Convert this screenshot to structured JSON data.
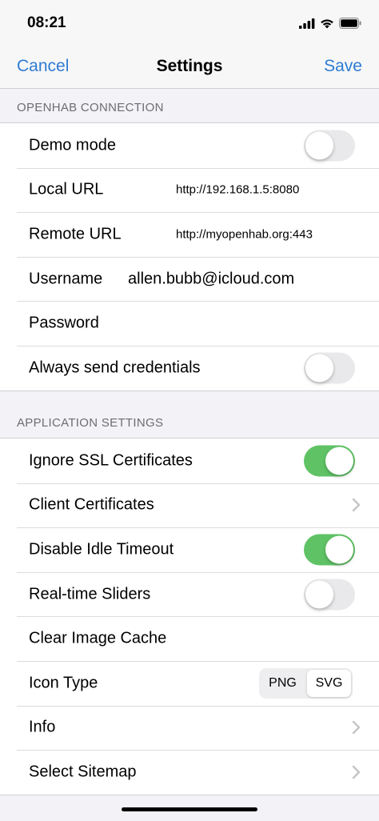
{
  "status_bar": {
    "time": "08:21"
  },
  "nav": {
    "cancel": "Cancel",
    "title": "Settings",
    "save": "Save"
  },
  "openhab_connection": {
    "header": "OPENHAB CONNECTION",
    "demo_mode": {
      "label": "Demo mode",
      "on": false
    },
    "local_url": {
      "label": "Local URL",
      "value": "http://192.168.1.5:8080"
    },
    "remote_url": {
      "label": "Remote URL",
      "value": "http://myopenhab.org:443"
    },
    "username": {
      "label": "Username",
      "value": "allen.bubb@icloud.com"
    },
    "password": {
      "label": "Password",
      "value": ""
    },
    "always_send_credentials": {
      "label": "Always send credentials",
      "on": false
    }
  },
  "application_settings": {
    "header": "APPLICATION SETTINGS",
    "ignore_ssl": {
      "label": "Ignore SSL Certificates",
      "on": true
    },
    "client_certificates": {
      "label": "Client Certificates"
    },
    "disable_idle_timeout": {
      "label": "Disable Idle Timeout",
      "on": true
    },
    "realtime_sliders": {
      "label": "Real-time Sliders",
      "on": false
    },
    "clear_image_cache": {
      "label": "Clear Image Cache"
    },
    "icon_type": {
      "label": "Icon Type",
      "options": [
        "PNG",
        "SVG"
      ],
      "selected": "SVG"
    },
    "info": {
      "label": "Info"
    },
    "select_sitemap": {
      "label": "Select Sitemap"
    }
  },
  "colors": {
    "accent": "#2f7bd3",
    "toggle_on": "#5fc365",
    "background": "#f2f2f7"
  }
}
